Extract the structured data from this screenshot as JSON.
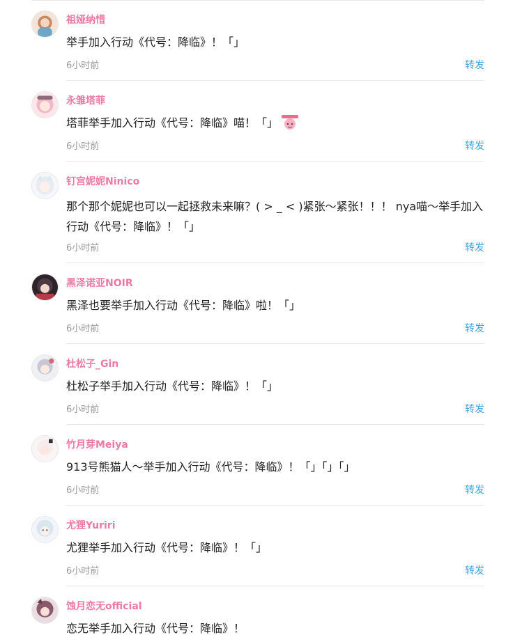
{
  "posts": [
    {
      "username": "祖娅纳惜",
      "text": "举手加入行动《代号：降临》！「」",
      "time": "6小时前",
      "action": "转发",
      "avatar_color": "#c98a62"
    },
    {
      "username": "永雏塔菲",
      "text": "塔菲举手加入行动《代号：降临》喵！「」",
      "time": "6小时前",
      "action": "转发",
      "avatar_color": "#f2b8c6",
      "emoji": "pink-character-sticker"
    },
    {
      "username": "钉宫妮妮Ninico",
      "text": "那个那个妮妮也可以一起拯救未来嘛？( > _ < )紧张～紧张！！！ nya喵～举手加入行动《代号：降临》！「」",
      "time": "6小时前",
      "action": "转发",
      "avatar_color": "#e7ecf2"
    },
    {
      "username": "黑泽诺亚NOIR",
      "text": "黑泽也要举手加入行动《代号：降临》啦！「」",
      "time": "6小时前",
      "action": "转发",
      "avatar_color": "#4a3a44"
    },
    {
      "username": "杜松子_Gin",
      "text": "杜松子举手加入行动《代号：降临》！「」",
      "time": "6小时前",
      "action": "转发",
      "avatar_color": "#c8c8d4"
    },
    {
      "username": "竹月芽Meiya",
      "text": "913号熊猫人～举手加入行动《代号：降临》！「」「」「」",
      "time": "6小时前",
      "action": "转发",
      "avatar_color": "#f4ecee"
    },
    {
      "username": "尤狸Yuriri",
      "text": "尤狸举手加入行动《代号：降临》！「」",
      "time": "6小时前",
      "action": "转发",
      "avatar_color": "#d9e6f0"
    },
    {
      "username": "蚀月恋无official",
      "text": "恋无举手加入行动《代号：降临》！",
      "time": "",
      "action": "",
      "avatar_color": "#8a5a6a"
    }
  ]
}
